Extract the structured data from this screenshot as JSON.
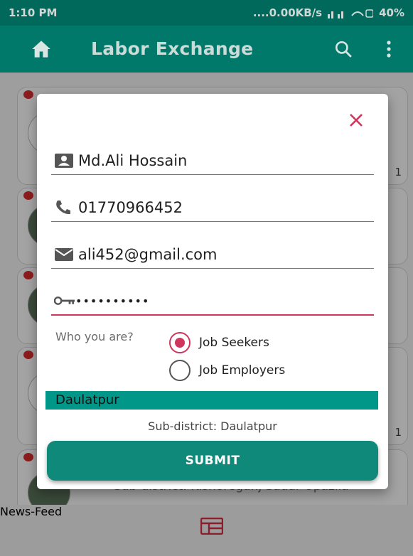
{
  "status_bar": {
    "time": "1:10 PM",
    "indicators": "....0.00KB/s",
    "battery": "40%"
  },
  "app_bar": {
    "title": "Labor Exchange",
    "icons": [
      "home-icon",
      "search-icon",
      "more-vert-icon"
    ]
  },
  "background_feed": {
    "partial_text": "Sub-district: Kishoreganj Sadar Upazila",
    "counts": [
      "1",
      "1"
    ]
  },
  "dialog": {
    "name": "Md.Ali Hossain",
    "phone": "01770966452",
    "email": "ali452@gmail.com",
    "password_mask": "••••••••••",
    "who_label": "Who you are?",
    "role_options": [
      {
        "label": "Job Seekers",
        "selected": true
      },
      {
        "label": "Job Employers",
        "selected": false
      }
    ],
    "district": "Daulatpur",
    "subdistrict": "Sub-district: Daulatpur",
    "submit_label": "SUBMIT"
  },
  "bottom_nav": {
    "label": "News-Feed"
  },
  "colors": {
    "primary": "#00796b",
    "primary_dark": "#00695c",
    "accent": "#d0365c",
    "button": "#0f8a7a"
  }
}
